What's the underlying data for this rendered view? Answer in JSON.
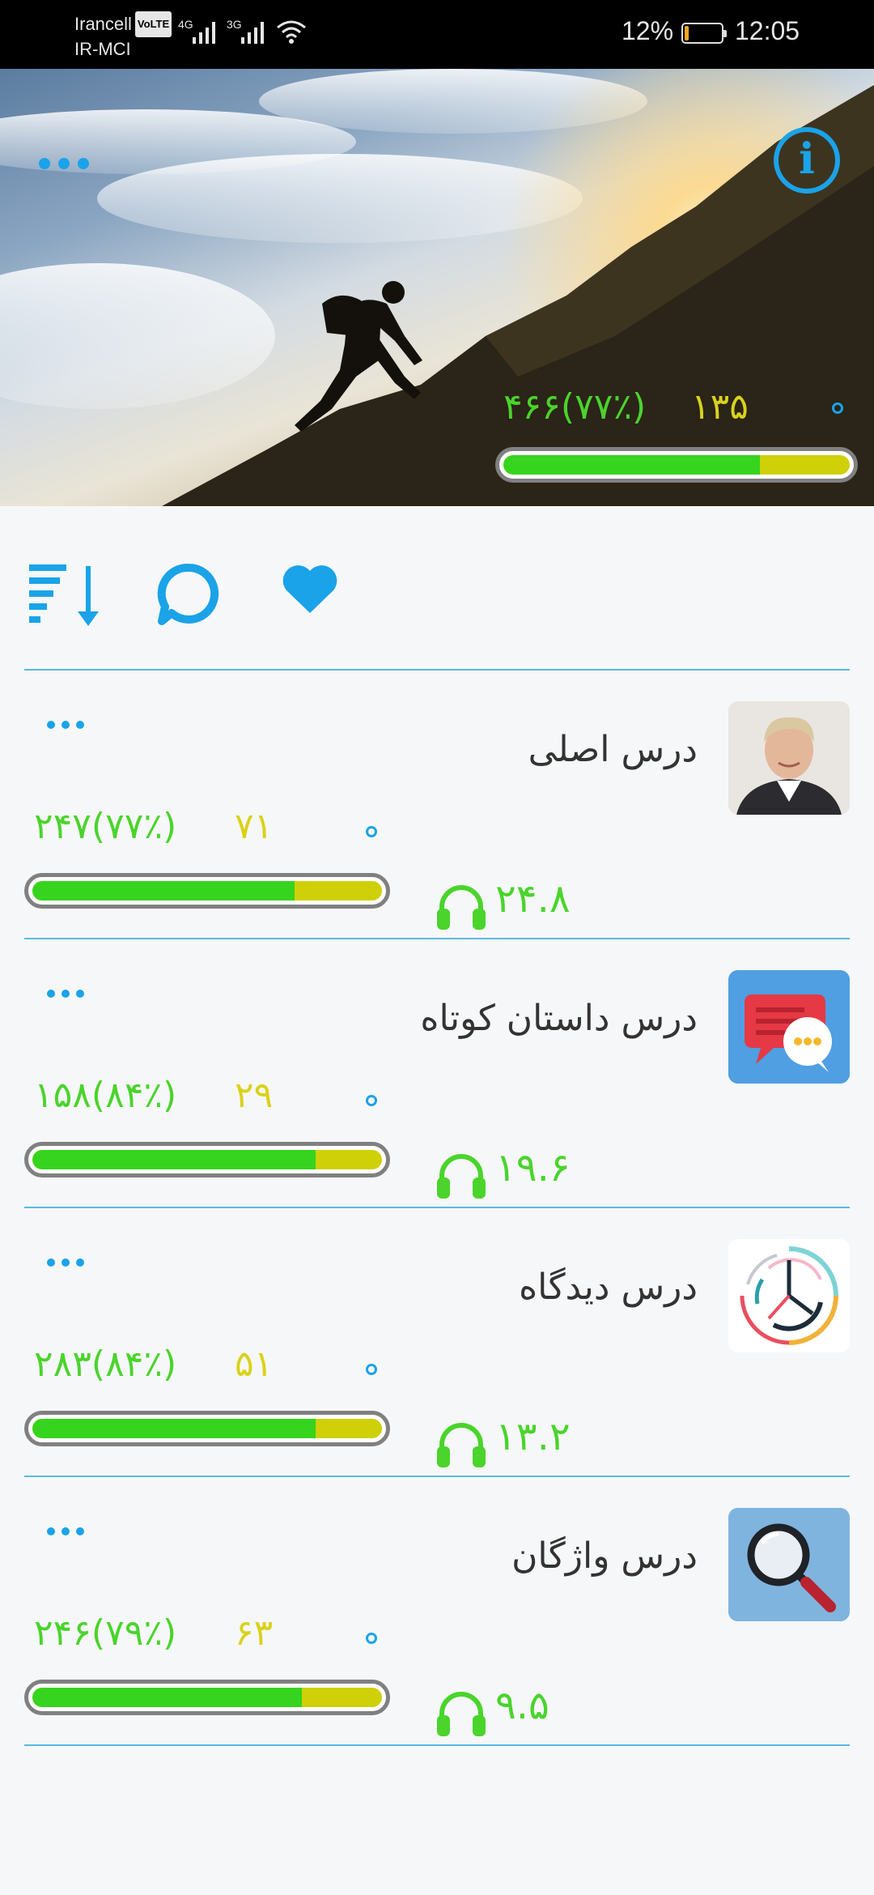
{
  "status_bar": {
    "carrier_1": "Irancell",
    "volte": "VoLTE",
    "carrier_2": "IR-MCI",
    "net_1": "4G",
    "net_2": "3G",
    "battery_percent": "12%",
    "battery_level": 0.12,
    "time": "12:05"
  },
  "hero": {
    "total_text": "۴۶۶(۷۷٪)",
    "count_text": "۱۳۵",
    "info_glyph": "i",
    "progress": {
      "green": 0.74,
      "yellow": 0.26
    }
  },
  "toolbar": {
    "icons": [
      "sort-icon",
      "chat-bubble-icon",
      "heart-icon"
    ]
  },
  "lessons": [
    {
      "title": "درس اصلی",
      "total_text": "۲۴۷(۷۷٪)",
      "count_text": "۷۱",
      "duration": "۲۴.۸",
      "progress_green": 0.75,
      "thumb": "portrait-image"
    },
    {
      "title": "درس داستان کوتاه",
      "total_text": "۱۵۸(۸۴٪)",
      "count_text": "۲۹",
      "duration": "۱۹.۶",
      "progress_green": 0.81,
      "thumb": "chat-bubbles-image"
    },
    {
      "title": "درس دیدگاه",
      "total_text": "۲۸۳(۸۴٪)",
      "count_text": "۵۱",
      "duration": "۱۳.۲",
      "progress_green": 0.81,
      "thumb": "clock-arcs-image"
    },
    {
      "title": "درس واژگان",
      "total_text": "۲۴۶(۷۹٪)",
      "count_text": "۶۳",
      "duration": "۹.۵",
      "progress_green": 0.77,
      "thumb": "magnifier-image"
    }
  ],
  "colors": {
    "accent_blue": "#1aa3e8",
    "green": "#4ad42c",
    "yellow": "#d9d21a",
    "bar_green": "#36d41e",
    "bar_yellow": "#cfd008"
  }
}
